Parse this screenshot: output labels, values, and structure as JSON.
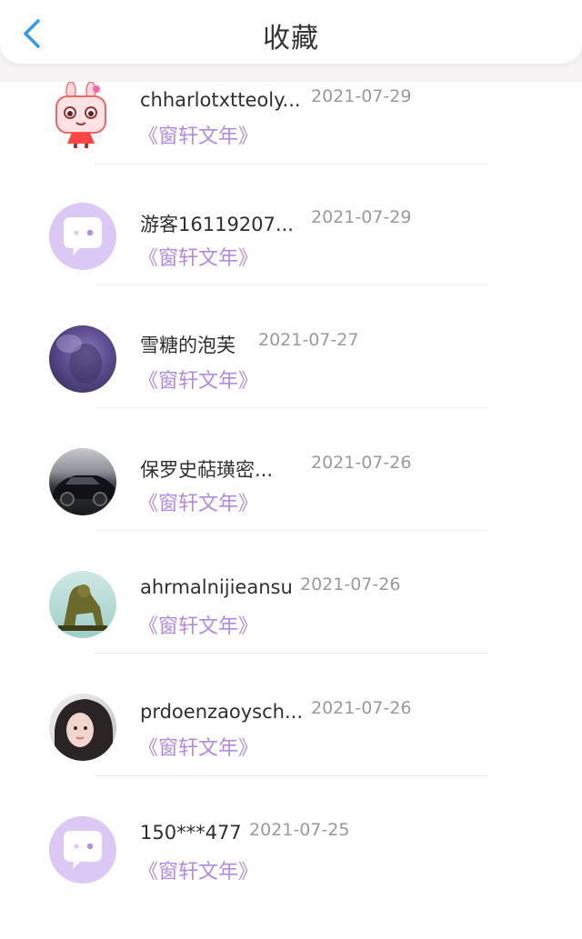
{
  "header": {
    "title": "收藏",
    "back_icon": "chevron-left-icon",
    "accent": "#2e9bf0"
  },
  "items": [
    {
      "name": "chharlotxtteoly...",
      "date": "2021-07-29",
      "book": "《窗轩文年》",
      "avatar": "cartoon-rabbit-avatar"
    },
    {
      "name": "游客16119207...",
      "date": "2021-07-29",
      "book": "《窗轩文年》",
      "avatar": "default-chat-avatar"
    },
    {
      "name": "雪糖的泡芙",
      "date": "2021-07-27",
      "book": "《窗轩文年》",
      "avatar": "purple-photo-avatar"
    },
    {
      "name": "保罗史萜璜密...",
      "date": "2021-07-26",
      "book": "《窗轩文年》",
      "avatar": "car-photo-avatar"
    },
    {
      "name": "ahrmalnijieansu",
      "date": "2021-07-26",
      "book": "《窗轩文年》",
      "avatar": "leopard-statue-avatar"
    },
    {
      "name": "prdoenzaoysch...",
      "date": "2021-07-26",
      "book": "《窗轩文年》",
      "avatar": "girl-photo-avatar"
    },
    {
      "name": "150***477",
      "date": "2021-07-25",
      "book": "《窗轩文年》",
      "avatar": "default-chat-avatar"
    }
  ],
  "colors": {
    "book_link": "#b18be0",
    "default_avatar": "#dcc8f5",
    "date": "#9a9a9a"
  }
}
